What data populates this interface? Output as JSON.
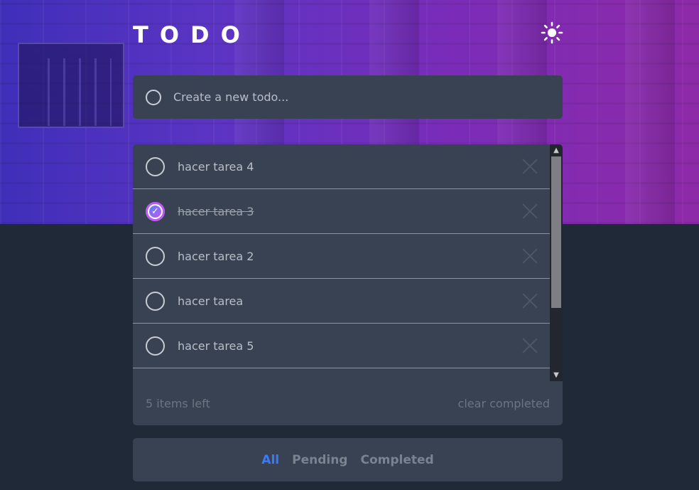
{
  "app": {
    "title": "TODO"
  },
  "theme_toggle": {
    "icon": "sun-icon"
  },
  "new_todo": {
    "placeholder": "Create a new todo..."
  },
  "todos": [
    {
      "text": "hacer tarea 4",
      "completed": false
    },
    {
      "text": "hacer tarea 3",
      "completed": true
    },
    {
      "text": "hacer tarea 2",
      "completed": false
    },
    {
      "text": "hacer tarea",
      "completed": false
    },
    {
      "text": "hacer tarea 5",
      "completed": false
    }
  ],
  "footer": {
    "items_left": "5 items left",
    "clear_label": "clear completed"
  },
  "filters": [
    {
      "label": "All",
      "active": true
    },
    {
      "label": "Pending",
      "active": false
    },
    {
      "label": "Completed",
      "active": false
    }
  ],
  "colors": {
    "accent": "#3a7bfd",
    "check_gradient_start": "#57ddff",
    "check_gradient_end": "#c058f3",
    "card_bg": "#384253",
    "page_bg": "#202938"
  }
}
